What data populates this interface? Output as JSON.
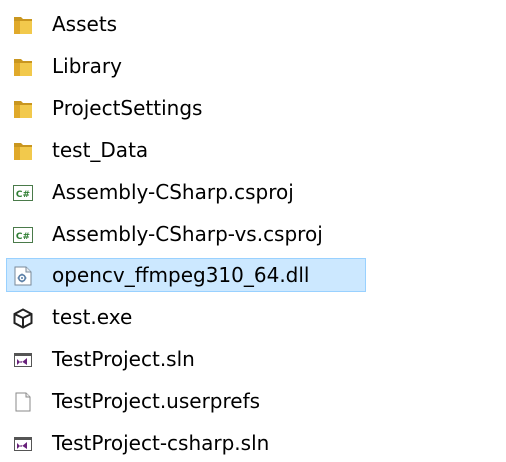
{
  "files": [
    {
      "name": "Assets",
      "icon": "folder-icon",
      "selected": false
    },
    {
      "name": "Library",
      "icon": "folder-icon",
      "selected": false
    },
    {
      "name": "ProjectSettings",
      "icon": "folder-icon",
      "selected": false
    },
    {
      "name": "test_Data",
      "icon": "folder-icon",
      "selected": false
    },
    {
      "name": "Assembly-CSharp.csproj",
      "icon": "csharp-project-icon",
      "selected": false
    },
    {
      "name": "Assembly-CSharp-vs.csproj",
      "icon": "csharp-project-icon",
      "selected": false
    },
    {
      "name": "opencv_ffmpeg310_64.dll",
      "icon": "dll-icon",
      "selected": true
    },
    {
      "name": "test.exe",
      "icon": "unity-icon",
      "selected": false
    },
    {
      "name": "TestProject.sln",
      "icon": "visual-studio-solution-icon",
      "selected": false
    },
    {
      "name": "TestProject.userprefs",
      "icon": "blank-file-icon",
      "selected": false
    },
    {
      "name": "TestProject-csharp.sln",
      "icon": "visual-studio-solution-icon",
      "selected": false
    }
  ],
  "colors": {
    "selection_background": "#cce8ff",
    "selection_border": "#99d1ff",
    "folder": "#e8b838",
    "visual_studio": "#68217a",
    "csharp_badge": "#2e7d32"
  }
}
